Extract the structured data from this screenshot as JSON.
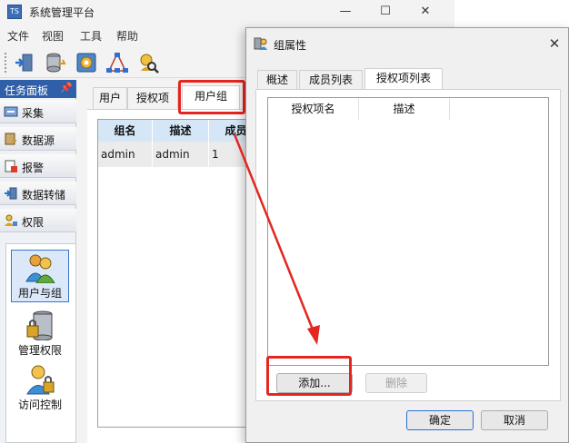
{
  "app": {
    "title": "系统管理平台",
    "icon_text": "TS",
    "controls": {
      "minimize": "—",
      "maximize": "☐",
      "close": "✕"
    }
  },
  "menu": [
    "文件",
    "视图",
    "工具",
    "帮助"
  ],
  "toolbar": {
    "buttons": [
      "import-icon",
      "database-icon",
      "settings-icon",
      "network-icon",
      "search-user-icon"
    ]
  },
  "task_panel": {
    "title": "任务面板",
    "pin": "📌",
    "items": [
      {
        "label": "采集",
        "icon": "collect-icon"
      },
      {
        "label": "数据源",
        "icon": "datasource-icon"
      },
      {
        "label": "报警",
        "icon": "alarm-icon"
      },
      {
        "label": "数据转储",
        "icon": "dump-icon"
      },
      {
        "label": "权限",
        "icon": "permission-icon"
      }
    ],
    "sub_items": [
      {
        "label": "用户与组",
        "icon": "users-groups-icon",
        "selected": true
      },
      {
        "label": "管理权限",
        "icon": "manage-permission-icon",
        "selected": false
      },
      {
        "label": "访问控制",
        "icon": "access-control-icon",
        "selected": false
      }
    ]
  },
  "content": {
    "tabs": [
      "用户",
      "授权项",
      "用户组"
    ],
    "active_tab": 2,
    "grid": {
      "columns": [
        "组名",
        "描述",
        "成员"
      ],
      "rows": [
        [
          "admin",
          "admin",
          "1"
        ]
      ]
    }
  },
  "dialog": {
    "title": "组属性",
    "close": "✕",
    "tabs": [
      "概述",
      "成员列表",
      "授权项列表"
    ],
    "active_tab": 2,
    "list_columns": [
      "授权项名",
      "描述"
    ],
    "sort_indicator": "^",
    "add_label": "添加...",
    "delete_label": "删除",
    "ok_label": "确定",
    "cancel_label": "取消"
  },
  "colors": {
    "highlight": "#e52620",
    "accent": "#2f5fa8",
    "grid_header": "#d5e6f7"
  }
}
